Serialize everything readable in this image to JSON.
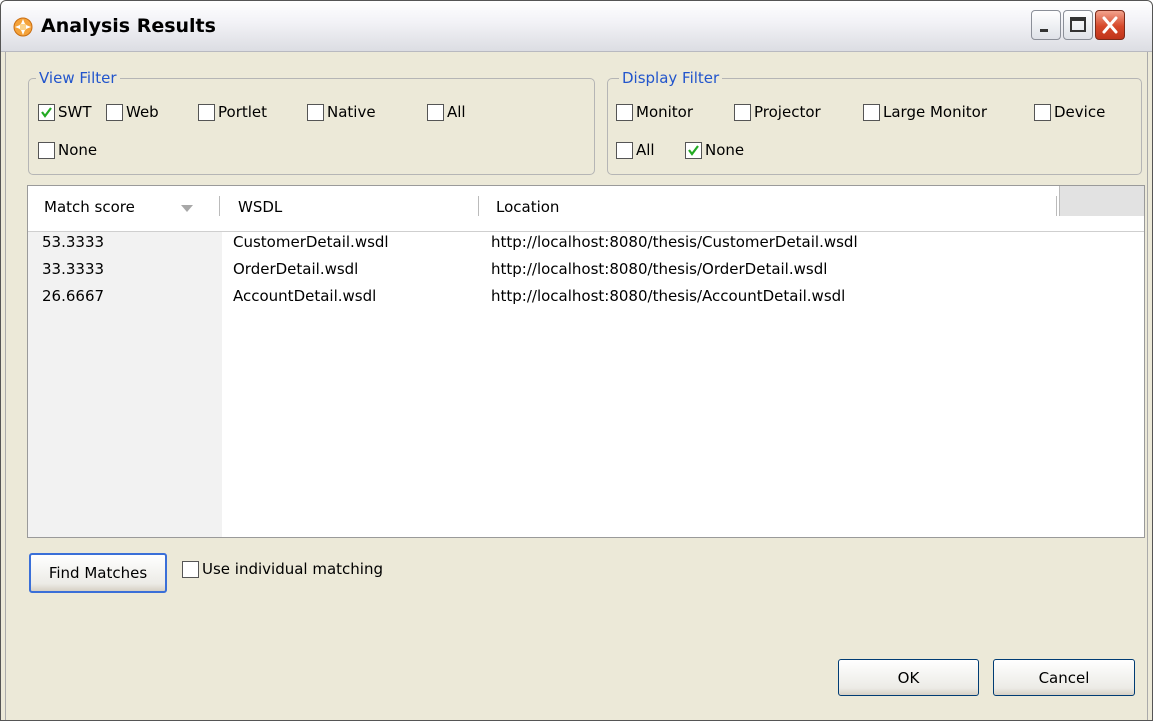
{
  "window": {
    "title": "Analysis Results"
  },
  "view_filter": {
    "legend": "View Filter",
    "options": [
      {
        "label": "SWT",
        "checked": true
      },
      {
        "label": "Web",
        "checked": false
      },
      {
        "label": "Portlet",
        "checked": false
      },
      {
        "label": "Native",
        "checked": false
      },
      {
        "label": "All",
        "checked": false
      },
      {
        "label": "None",
        "checked": false
      }
    ]
  },
  "display_filter": {
    "legend": "Display Filter",
    "options": [
      {
        "label": "Monitor",
        "checked": false
      },
      {
        "label": "Projector",
        "checked": false
      },
      {
        "label": "Large Monitor",
        "checked": false
      },
      {
        "label": "Device",
        "checked": false
      },
      {
        "label": "All",
        "checked": false
      },
      {
        "label": "None",
        "checked": true
      }
    ]
  },
  "table": {
    "columns": [
      "Match score",
      "WSDL",
      "Location"
    ],
    "sort_icon": "sort-descending-icon",
    "rows": [
      [
        "53.3333",
        "CustomerDetail.wsdl",
        "http://localhost:8080/thesis/CustomerDetail.wsdl"
      ],
      [
        "33.3333",
        "OrderDetail.wsdl",
        "http://localhost:8080/thesis/OrderDetail.wsdl"
      ],
      [
        "26.6667",
        "AccountDetail.wsdl",
        "http://localhost:8080/thesis/AccountDetail.wsdl"
      ]
    ]
  },
  "actions": {
    "find_label": "Find Matches",
    "individual_label": "Use individual matching",
    "individual_checked": false,
    "ok_label": "OK",
    "cancel_label": "Cancel"
  },
  "colors": {
    "legend": "#2255cc",
    "check": "#22aa22",
    "close": "#d6482a"
  }
}
